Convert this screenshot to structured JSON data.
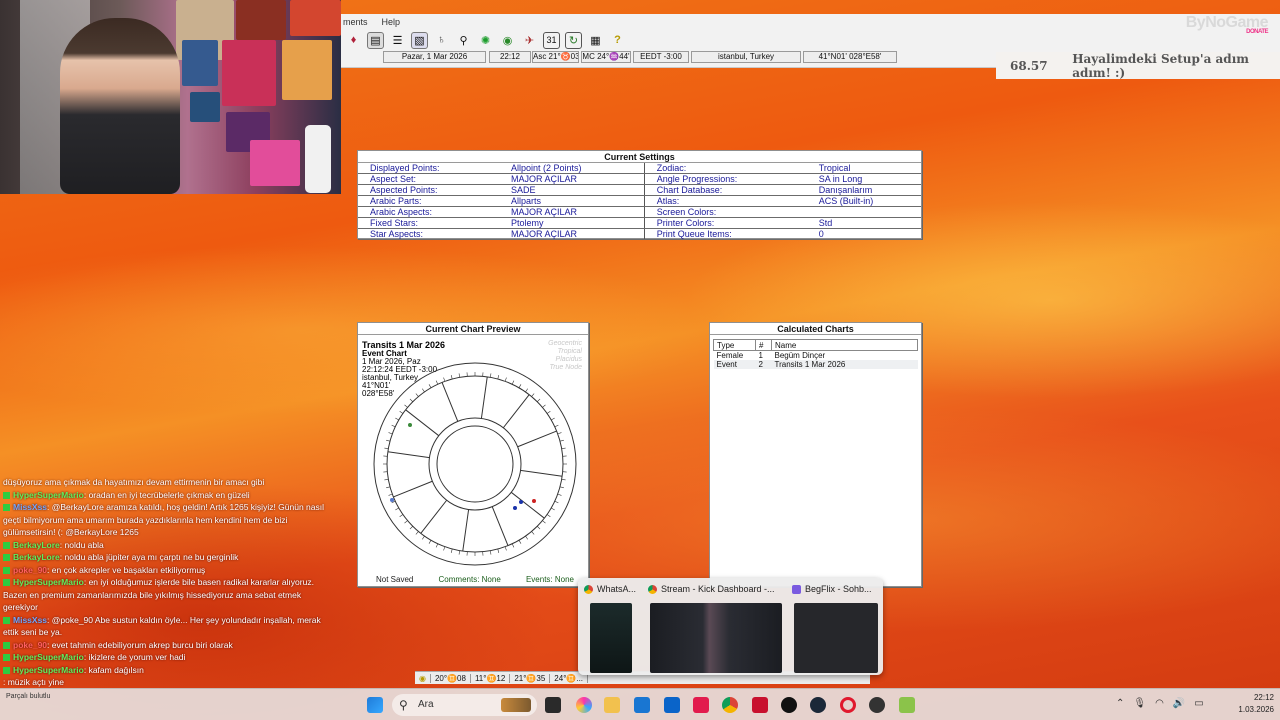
{
  "app": {
    "menu": [
      "ments",
      "Help"
    ],
    "toolbar_icons": [
      "chart-wheel-icon",
      "notepad-icon",
      "list-icon",
      "image-icon",
      "planet-icon",
      "binoculars-icon",
      "sun-icon",
      "globe-icon",
      "rocket-icon",
      "calendar-icon",
      "refresh-icon",
      "grid-icon",
      "help-icon"
    ],
    "status": {
      "date": "Pazar, 1 Mar 2026",
      "time": "22:12",
      "asc": "Asc 21°♉03'",
      "mc": "MC 24°♒44'",
      "tz": "EEDT -3:00",
      "place": "istanbul, Turkey",
      "coords": "41°N01' 028°E58'"
    }
  },
  "brand": {
    "name": "ByNoGame",
    "sub": "DONATE"
  },
  "ticker": {
    "number": "68.57",
    "text": "Hayalimdeki Setup'a adım adım! :)"
  },
  "settings": {
    "title": "Current Settings",
    "rows": [
      {
        "l1": "Displayed Points:",
        "v1": "Allpoint  (2 Points)",
        "l2": "Zodiac:",
        "v2": "Tropical"
      },
      {
        "l1": "Aspect Set:",
        "v1": "MAJOR AÇILAR",
        "l2": "Angle Progressions:",
        "v2": "SA in Long"
      },
      {
        "l1": "Aspected Points:",
        "v1": "SADE",
        "l2": "Chart Database:",
        "v2": "Danışanlarım"
      },
      {
        "l1": "Arabic Parts:",
        "v1": "Allparts",
        "l2": "Atlas:",
        "v2": "ACS  (Built-in)"
      },
      {
        "l1": "Arabic Aspects:",
        "v1": "MAJOR AÇILAR",
        "l2": "Screen Colors:",
        "v2": ""
      },
      {
        "l1": "Fixed Stars:",
        "v1": "Ptolemy",
        "l2": "Printer Colors:",
        "v2": "Std"
      },
      {
        "l1": "Star Aspects:",
        "v1": "MAJOR AÇILAR",
        "l2": "Print Queue Items:",
        "v2": "0"
      }
    ]
  },
  "preview": {
    "title": "Current Chart Preview",
    "chart_title": "Transits 1 Mar 2026",
    "chart_lines": [
      "Event Chart",
      "1 Mar 2026, Paz",
      "22:12:24  EEDT -3:00",
      "istanbul, Turkey",
      "41°N01'",
      "028°E58'"
    ],
    "chart_meta": [
      "Geocentric",
      "Tropical",
      "Placidus",
      "True Node"
    ],
    "status_left": "Not Saved",
    "status_mid": "Comments: None",
    "status_right": "Events: None"
  },
  "calculated": {
    "title": "Calculated Charts",
    "headers": [
      "Type",
      "#",
      "Name"
    ],
    "rows": [
      {
        "type": "Female",
        "num": "1",
        "name": "Begüm Dinçer"
      },
      {
        "type": "Event",
        "num": "2",
        "name": "Transits 1 Mar 2026"
      }
    ]
  },
  "chat": [
    {
      "user": "",
      "text": "düşüyoruz ama çıkmak da hayatımızı devam ettirmenin bir amacı gibi"
    },
    {
      "user": "HyperSuperMario",
      "text": ": oradan en iyi tecrübelerle çıkmak en güzeli"
    },
    {
      "user": "MissXss",
      "text": ": @BerkayLore aramıza katıldı, hoş geldin! Artık 1265 kişiyiz! Günün nasıl geçti bilmiyorum ama umarım burada yazdıklarınla hem kendini hem de bizi gülümsetirsin! (: @BerkayLore 1265"
    },
    {
      "user": "BerkayLore",
      "text": ": noldu abla"
    },
    {
      "user": "BerkayLore",
      "text": ": noldu abla jüpiter aya mı çarptı ne bu gerginlik"
    },
    {
      "user": "poke_90",
      "text": ": en çok akrepler ve başakları etkiliyormuş"
    },
    {
      "user": "HyperSuperMario",
      "text": ": en iyi olduğumuz işlerde bile basen radikal kararlar alıyoruz. Bazen en premium zamanlarımızda bile yıkılmış hissediyoruz ama sebat etmek gerekiyor"
    },
    {
      "user": "MissXss",
      "text": ": @poke_90 Abe sustun kaldın öyle... Her şey yolundadır inşallah, merak ettik seni be ya."
    },
    {
      "user": "poke_90",
      "text": ": evet tahmin edebiliyorum akrep burcu biri olarak"
    },
    {
      "user": "HyperSuperMario",
      "text": ": ikizlere de yorum ver hadi"
    },
    {
      "user": "HyperSuperMario",
      "text": ": kafam dağılsın"
    },
    {
      "user": "",
      "text": ": müzik açtı yine"
    }
  ],
  "bottom_strip": [
    "20°♊08",
    "11°♊12",
    "21°♊35",
    "24°♊..."
  ],
  "previews": [
    {
      "title": "WhatsA..."
    },
    {
      "title": "Stream - Kick Dashboard -..."
    },
    {
      "title": "BegFlix - Sohb..."
    }
  ],
  "taskbar": {
    "search_placeholder": "Ara",
    "time": "22:12",
    "date": "1.03.2026",
    "weather": "Parçalı bulutlu"
  }
}
